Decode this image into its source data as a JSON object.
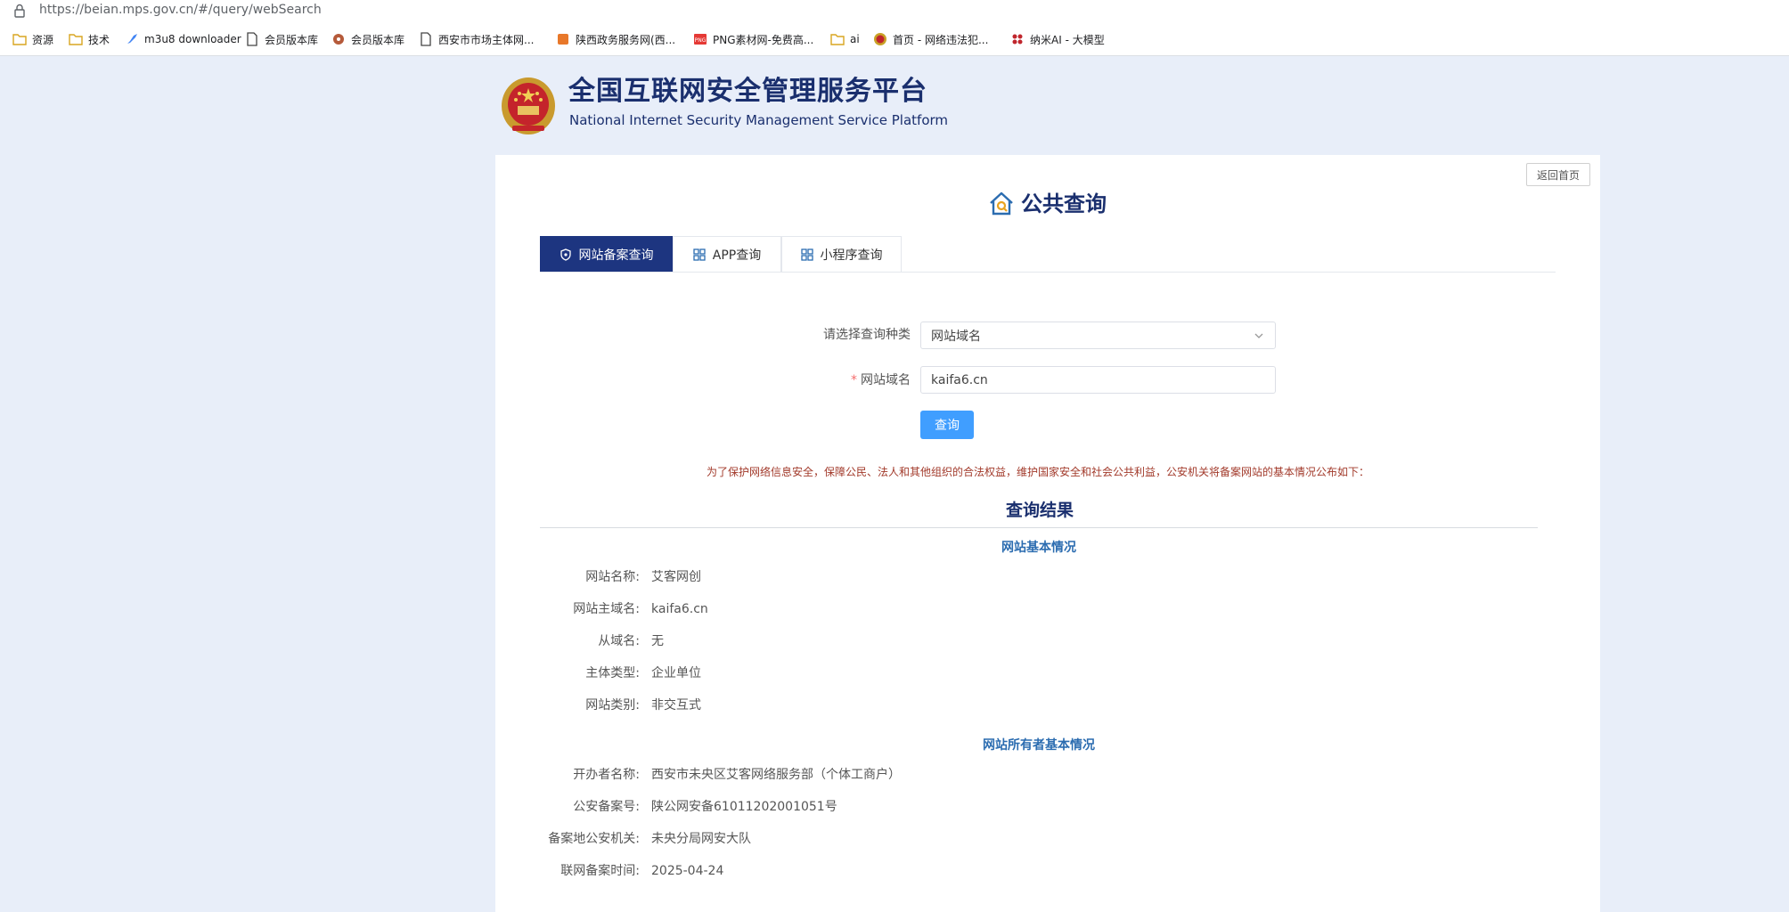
{
  "browser": {
    "url": "https://beian.mps.gov.cn/#/query/webSearch",
    "bookmarks": [
      {
        "label": "资源",
        "icon": "folder-icon"
      },
      {
        "label": "技术",
        "icon": "folder-icon"
      },
      {
        "label": "m3u8 downloader",
        "icon": "rocket-icon"
      },
      {
        "label": "会员版本库",
        "icon": "page-icon"
      },
      {
        "label": "会员版本库",
        "icon": "gear-icon"
      },
      {
        "label": "西安市市场主体网...",
        "icon": "page-icon"
      },
      {
        "label": "陕西政务服务网(西...",
        "icon": "shaanxi-icon"
      },
      {
        "label": "PNG素材网-免费高...",
        "icon": "png-icon"
      },
      {
        "label": "ai",
        "icon": "folder-icon"
      },
      {
        "label": "首页 - 网络违法犯...",
        "icon": "emblem-icon"
      },
      {
        "label": "纳米AI - 大模型",
        "icon": "nami-icon"
      }
    ]
  },
  "header": {
    "title_cn": "全国互联网安全管理服务平台",
    "title_en": "National Internet Security Management Service Platform"
  },
  "page": {
    "back_home": "返回首页",
    "title": "公共查询",
    "tabs": [
      {
        "label": "网站备案查询",
        "active": true
      },
      {
        "label": "APP查询",
        "active": false
      },
      {
        "label": "小程序查询",
        "active": false
      }
    ]
  },
  "form": {
    "type_label": "请选择查询种类",
    "type_value": "网站域名",
    "domain_required": "*",
    "domain_label": "网站域名",
    "domain_value": "kaifa6.cn",
    "query_button": "查询"
  },
  "notice": "为了保护网络信息安全，保障公民、法人和其他组织的合法权益，维护国家安全和社会公共利益，公安机关将备案网站的基本情况公布如下：",
  "results": {
    "title": "查询结果",
    "site_section": "网站基本情况",
    "site_rows": [
      {
        "label": "网站名称:",
        "value": "艾客网创"
      },
      {
        "label": "网站主域名:",
        "value": "kaifa6.cn"
      },
      {
        "label": "从域名:",
        "value": "无"
      },
      {
        "label": "主体类型:",
        "value": "企业单位"
      },
      {
        "label": "网站类别:",
        "value": "非交互式"
      }
    ],
    "owner_section": "网站所有者基本情况",
    "owner_rows": [
      {
        "label": "开办者名称:",
        "value": "西安市未央区艾客网络服务部（个体工商户）"
      },
      {
        "label": "公安备案号:",
        "value": "陕公网安备61011202001051号"
      },
      {
        "label": "备案地公安机关:",
        "value": "未央分局网安大队"
      },
      {
        "label": "联网备案时间:",
        "value": "2025-04-24"
      }
    ]
  },
  "colors": {
    "brand_navy": "#1a2f6e",
    "active_tab": "#1d3580",
    "primary_button": "#409eff",
    "notice_red": "#a23a2b",
    "page_bg": "#e8eef9"
  }
}
